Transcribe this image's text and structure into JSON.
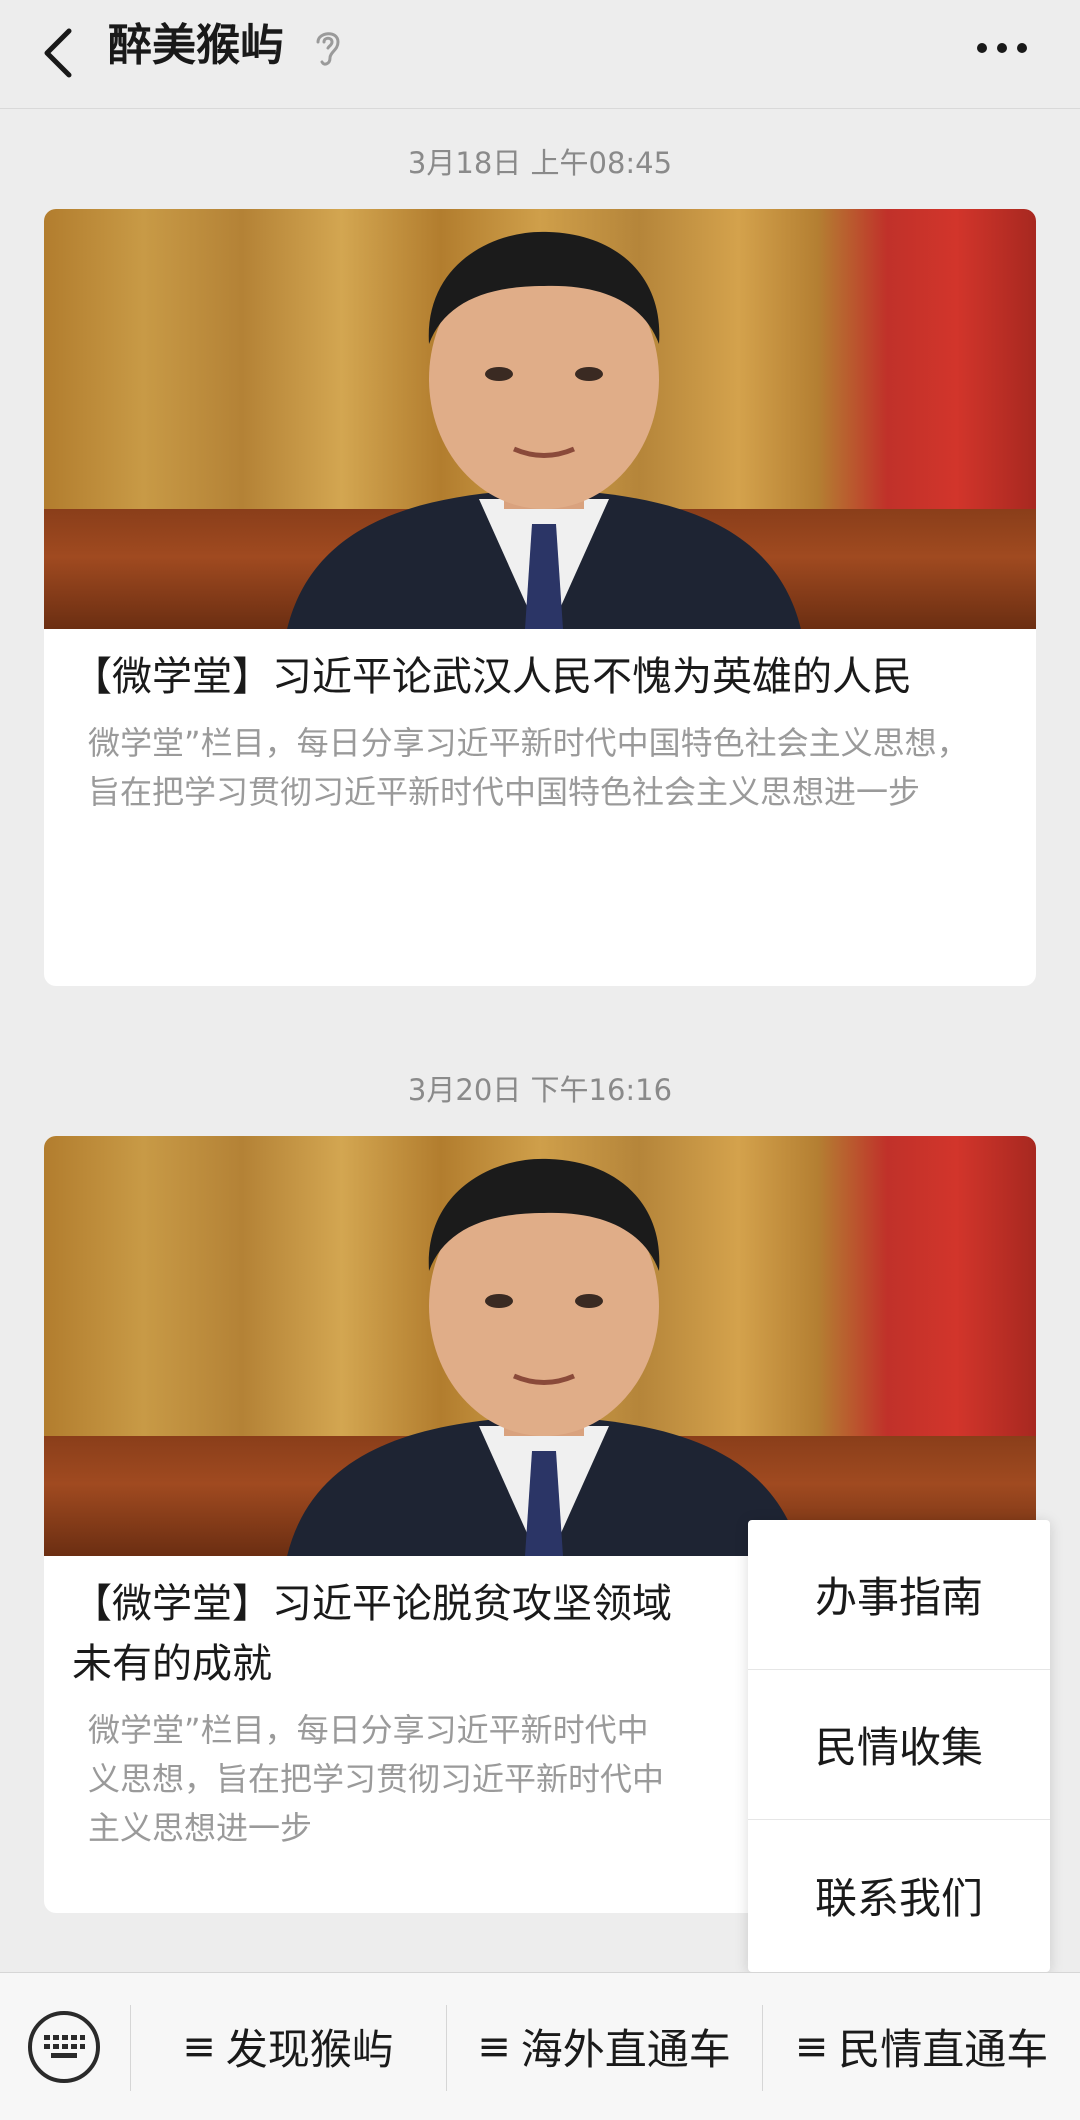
{
  "header": {
    "title": "醉美猴屿"
  },
  "messages": [
    {
      "timestamp": "3月18日 上午08:45",
      "title": "【微学堂】习近平论武汉人民不愧为英雄的人民",
      "description": "微学堂”栏目，每日分享习近平新时代中国特色社会主义思想，旨在把学习贯彻习近平新时代中国特色社会主义思想进一步"
    },
    {
      "timestamp": "3月20日 下午16:16",
      "title": "【微学堂】习近平论脱贫攻坚领域取得前所未有的成就",
      "title_visible_line1": "【微学堂】习近平论脱贫攻坚领域",
      "title_visible_line2": "未有的成就",
      "description_visible_line1": "微学堂”栏目，每日分享习近平新时代中",
      "description_visible_line2": "义思想，旨在把学习贯彻习近平新时代中",
      "description_visible_line3": "主义思想进一步"
    }
  ],
  "popup_menu": {
    "items": [
      "办事指南",
      "民情收集",
      "联系我们"
    ]
  },
  "bottom_bar": {
    "tabs": [
      "发现猴屿",
      "海外直通车",
      "民情直通车"
    ]
  },
  "icons": {
    "back": "chevron-left-icon",
    "ear": "ear-icon",
    "more": "more-dots-icon",
    "keyboard": "keyboard-icon",
    "menu": "menu-lines-icon"
  }
}
